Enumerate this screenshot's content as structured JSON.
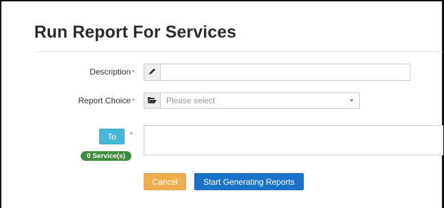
{
  "page": {
    "title": "Run Report For Services"
  },
  "form": {
    "description": {
      "label": "Description",
      "required_mark": "*",
      "icon": "pencil-icon",
      "value": ""
    },
    "report_choice": {
      "label": "Report Choice",
      "required_mark": "*",
      "icon": "folder-open-icon",
      "placeholder": "Please select"
    },
    "to": {
      "button_label": "To",
      "required_mark": "*",
      "badge": "0 Service(s)",
      "value": ""
    }
  },
  "actions": {
    "cancel_label": "Cancel",
    "start_label": "Start Generating Reports"
  },
  "colors": {
    "to_button": "#46b8da",
    "cancel_button": "#f0ad4e",
    "start_button": "#1a73c8",
    "badge": "#3d8b3d",
    "required": "#d9534f"
  }
}
